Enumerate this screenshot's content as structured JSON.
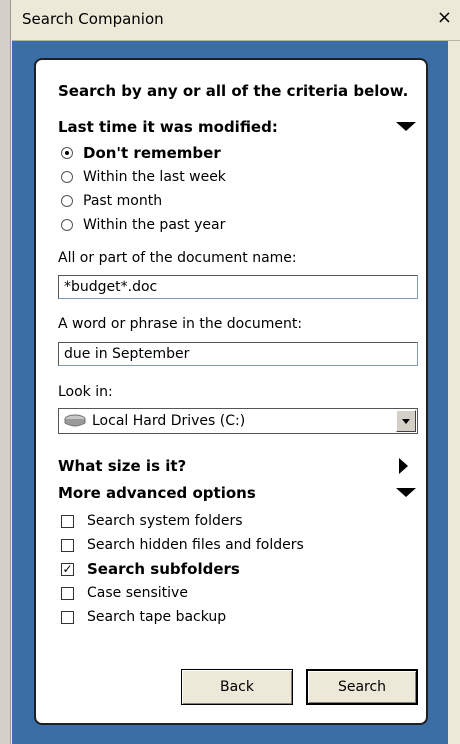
{
  "window": {
    "title": "Search Companion",
    "close_label": "×"
  },
  "panel": {
    "heading": "Search by any or all of the criteria below.",
    "modified": {
      "label": "Last time it was modified:",
      "options": [
        "Don't remember",
        "Within the last week",
        "Past month",
        "Within the past year"
      ],
      "selected": 0
    },
    "name_field": {
      "label": "All or part of the document name:",
      "value": "*budget*.doc"
    },
    "phrase_field": {
      "label": "A word or phrase in the document:",
      "value": "due in September"
    },
    "look_in": {
      "label": "Look in:",
      "value": "Local Hard Drives (C:)"
    },
    "size_section": "What size is it?",
    "advanced": {
      "label": "More advanced options",
      "options": [
        {
          "label": "Search system folders",
          "checked": false
        },
        {
          "label": "Search hidden files and folders",
          "checked": false
        },
        {
          "label": "Search subfolders",
          "checked": true
        },
        {
          "label": "Case sensitive",
          "checked": false
        },
        {
          "label": "Search tape backup",
          "checked": false
        }
      ]
    },
    "buttons": {
      "back": "Back",
      "search": "Search"
    }
  }
}
